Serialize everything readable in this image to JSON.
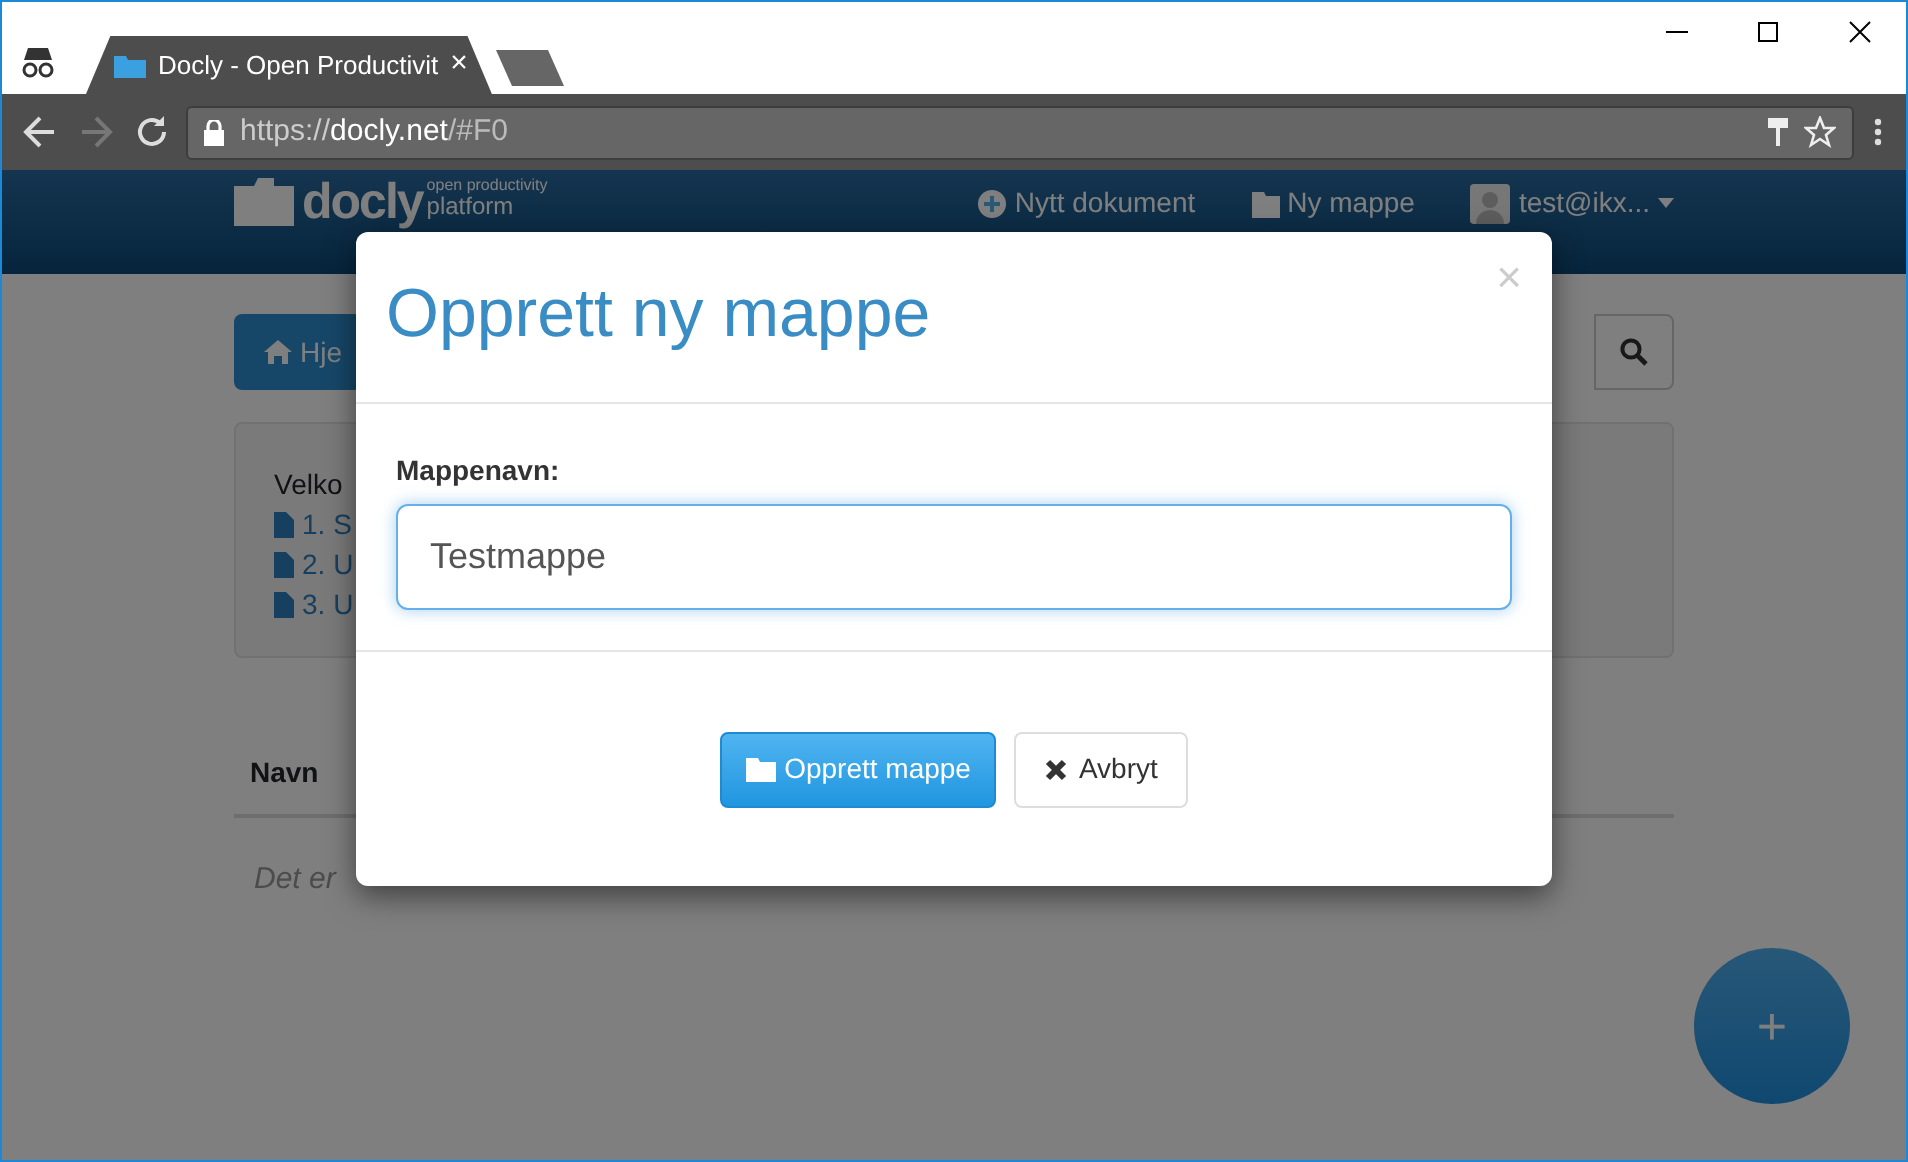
{
  "browser": {
    "tabs": [
      {
        "title": "Docly - Open Productivit",
        "close": "×",
        "selected": true
      }
    ],
    "url": {
      "scheme": "https://",
      "host": "docly.net",
      "path": "/#F0"
    }
  },
  "navbar": {
    "logo": "docly",
    "tagline_1": "open productivity",
    "tagline_2": "platform",
    "items": [
      {
        "label": "Nytt dokument"
      },
      {
        "label": "Ny mappe"
      },
      {
        "label": "test@ikx..."
      }
    ]
  },
  "page": {
    "home_button": "Hje",
    "welcome": "Velko",
    "links": [
      "1. S",
      "2. U",
      "3. U"
    ],
    "table_header": "Navn",
    "empty_text": "Det er",
    "fab": "+"
  },
  "modal": {
    "title": "Opprett ny mappe",
    "close": "×",
    "label": "Mappenavn:",
    "value": "Testmappe",
    "buttons": [
      {
        "kind": "primary",
        "label": "Opprett mappe"
      },
      {
        "kind": "cancel",
        "label": "Avbryt"
      }
    ]
  }
}
